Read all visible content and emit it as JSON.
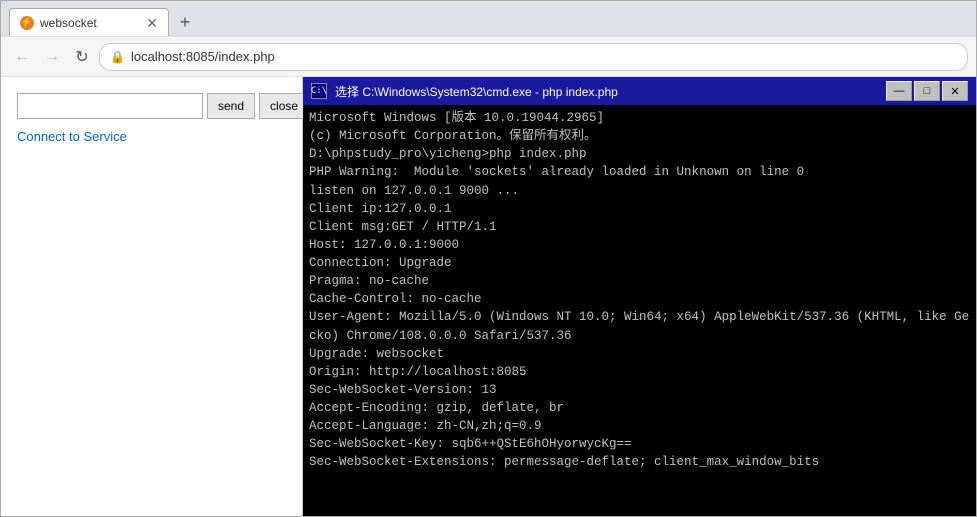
{
  "browser": {
    "tab_label": "websocket",
    "address": "localhost:8085/index.php",
    "nav": {
      "back": "←",
      "forward": "→",
      "refresh": "↻"
    }
  },
  "left_panel": {
    "send_label": "send",
    "close_label": "close",
    "connect_label": "Connect to Service",
    "message_placeholder": ""
  },
  "cmd": {
    "title": "选择 C:\\Windows\\System32\\cmd.exe - php  index.php",
    "lines": [
      "Microsoft Windows [版本 10.0.19044.2965]",
      "(c) Microsoft Corporation。保留所有权利。",
      "",
      "D:\\phpstudy_pro\\yicheng>php index.php",
      "PHP Warning:  Module 'sockets' already loaded in Unknown on line 0",
      "listen on 127.0.0.1 9000 ...",
      "Client ip:127.0.0.1",
      "Client msg:GET / HTTP/1.1",
      "Host: 127.0.0.1:9000",
      "Connection: Upgrade",
      "Pragma: no-cache",
      "Cache-Control: no-cache",
      "User-Agent: Mozilla/5.0 (Windows NT 10.0; Win64; x64) AppleWebKit/537.36 (KHTML, like Gecko) Chrome/108.0.0.0 Safari/537.36",
      "Upgrade: websocket",
      "Origin: http://localhost:8085",
      "Sec-WebSocket-Version: 13",
      "Accept-Encoding: gzip, deflate, br",
      "Accept-Language: zh-CN,zh;q=0.9",
      "Sec-WebSocket-Key: sqb6++QStE6hOHyorwycKg==",
      "Sec-WebSocket-Extensions: permessage-deflate; client_max_window_bits"
    ]
  }
}
